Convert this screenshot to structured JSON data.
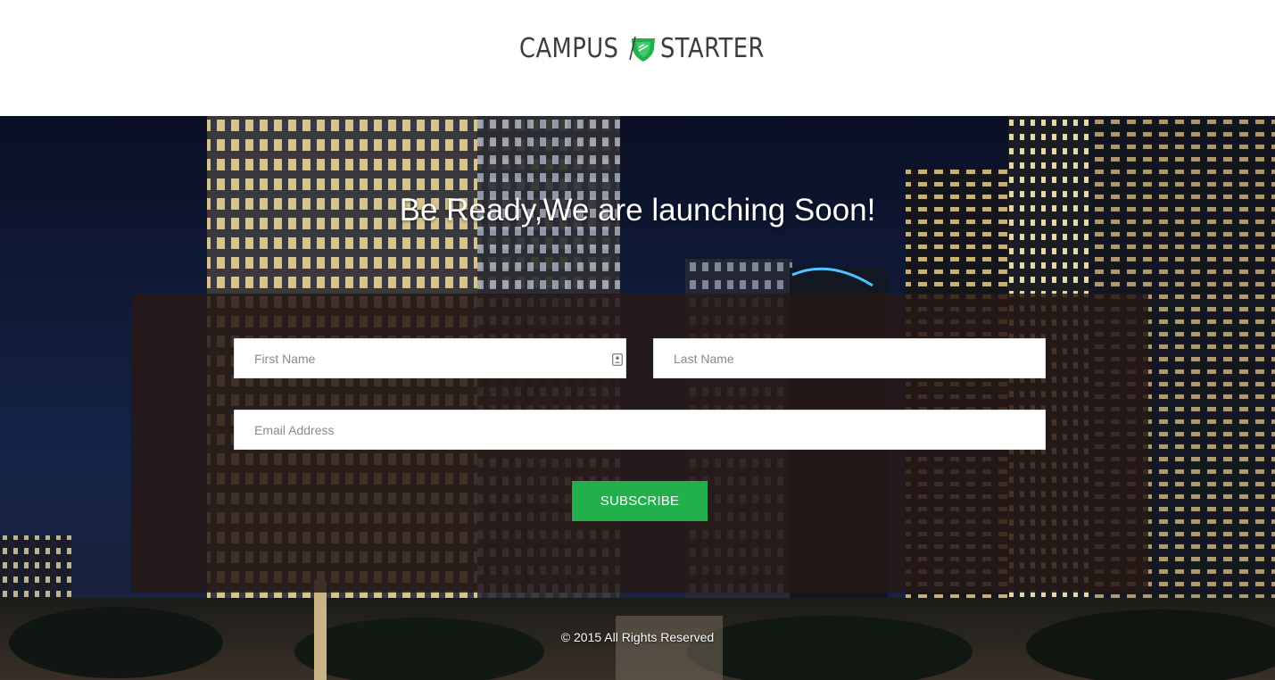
{
  "brand": {
    "logo_left": "CAMPUS",
    "logo_right": "STARTER",
    "shield_icon": "shield-icon",
    "accent_color": "#21b04b"
  },
  "hero": {
    "headline": "Be Ready,We are launching Soon!"
  },
  "form": {
    "first_name_placeholder": "First Name",
    "last_name_placeholder": "Last Name",
    "email_placeholder": "Email Address",
    "submit_label": "SUBSCRIBE",
    "autofill_icon": "contact-card-icon"
  },
  "footer": {
    "copyright": "© 2015 All Rights Reserved"
  }
}
